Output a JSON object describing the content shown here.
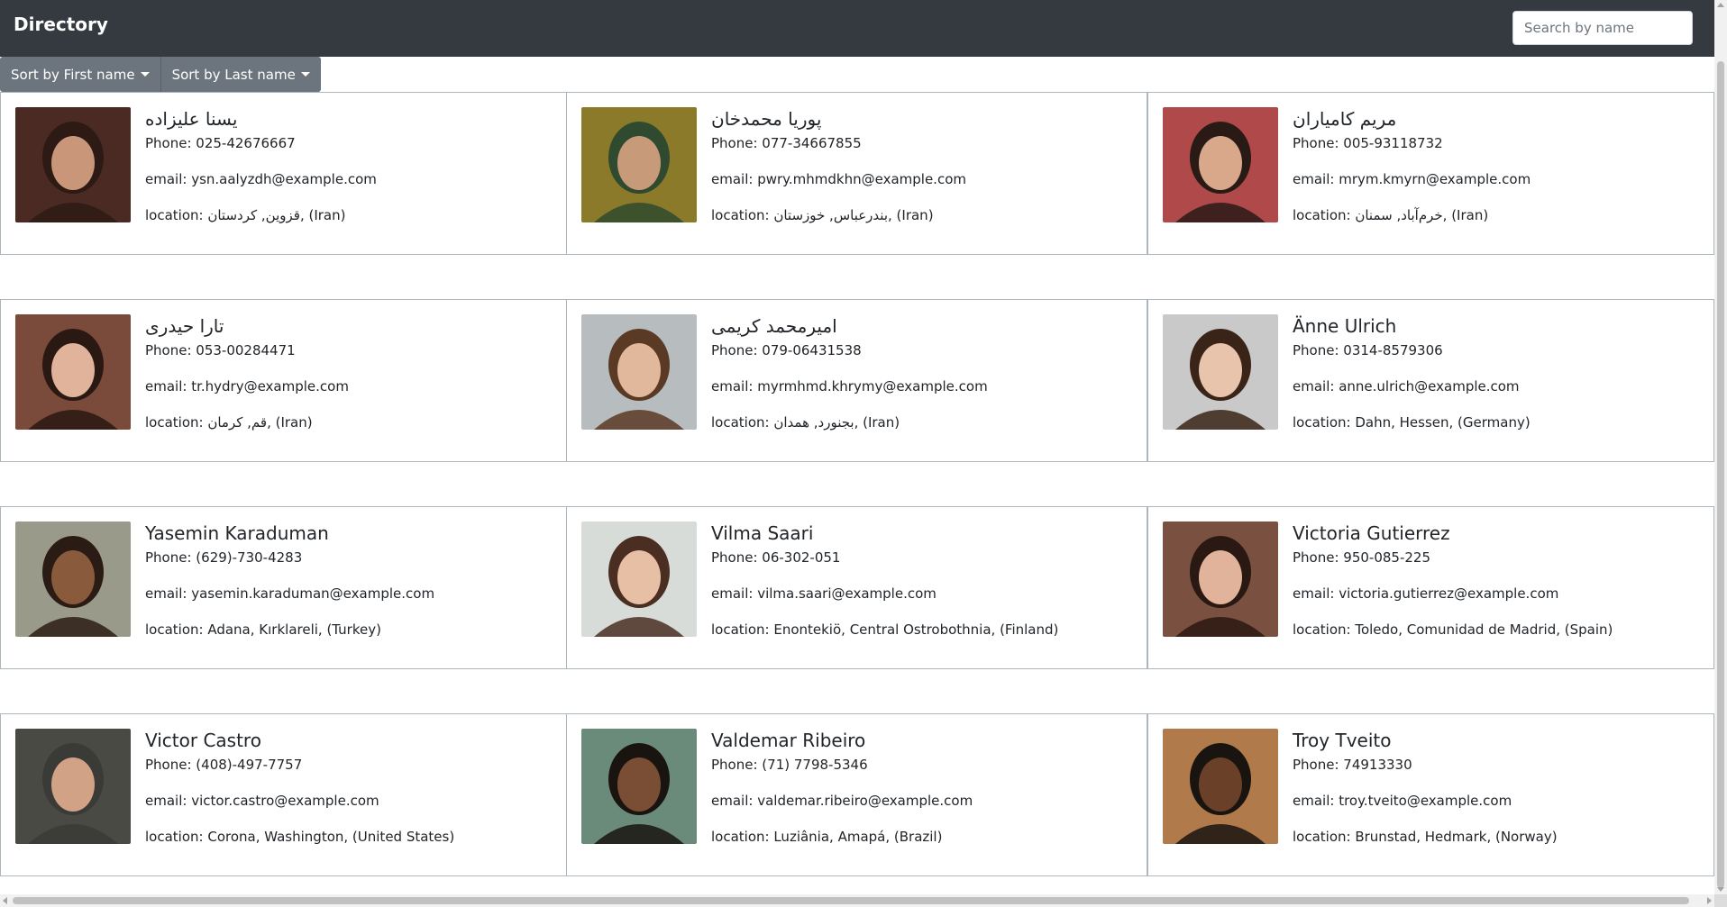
{
  "navbar": {
    "brand": "Directory",
    "search_placeholder": "Search by name",
    "search_value": ""
  },
  "sort": {
    "first_name_label": "Sort by First name",
    "last_name_label": "Sort by Last name"
  },
  "labels": {
    "phone": "Phone: ",
    "email": "email: ",
    "location": "location: "
  },
  "people": [
    {
      "name": "یسنا علیزاده",
      "phone": "025-42676667",
      "email": "ysn.aalyzdh@example.com",
      "location": "قزوین, کردستان, (Iran)",
      "photo_colors": [
        "#4a2a22",
        "#2d1a14",
        "#c9967a"
      ]
    },
    {
      "name": "پوریا محمدخان",
      "phone": "077-34667855",
      "email": "pwry.mhmdkhn@example.com",
      "location": "بندرعباس, خوزستان, (Iran)",
      "photo_colors": [
        "#8a7a2a",
        "#2f4a2e",
        "#c79a7a"
      ]
    },
    {
      "name": "مریم کامیاران",
      "phone": "005-93118732",
      "email": "mrym.kmyrn@example.com",
      "location": "خرم‌آباد, سمنان, (Iran)",
      "photo_colors": [
        "#b04a4a",
        "#2a1a16",
        "#d9a88a"
      ]
    },
    {
      "name": "تارا حیدری",
      "phone": "053-00284471",
      "email": "tr.hydry@example.com",
      "location": "قم, کرمان, (Iran)",
      "photo_colors": [
        "#7a4a3a",
        "#2a1812",
        "#e0b39a"
      ]
    },
    {
      "name": "امیرمحمد کریمی",
      "phone": "079-06431538",
      "email": "myrmhmd.khrymy@example.com",
      "location": "بجنورد, همدان, (Iran)",
      "photo_colors": [
        "#b7bcbf",
        "#5a3a24",
        "#e2b89c"
      ]
    },
    {
      "name": "Änne Ulrich",
      "phone": "0314-8579306",
      "email": "anne.ulrich@example.com",
      "location": "Dahn, Hessen, (Germany)",
      "photo_colors": [
        "#c9c9c9",
        "#3a2418",
        "#e8c4ac"
      ]
    },
    {
      "name": "Yasemin Karaduman",
      "phone": "(629)-730-4283",
      "email": "yasemin.karaduman@example.com",
      "location": "Adana, Kırklareli, (Turkey)",
      "photo_colors": [
        "#9a9a8a",
        "#2a1c14",
        "#8a5a3c"
      ]
    },
    {
      "name": "Vilma Saari",
      "phone": "06-302-051",
      "email": "vilma.saari@example.com",
      "location": "Enontekiö, Central Ostrobothnia, (Finland)",
      "photo_colors": [
        "#d8dcd8",
        "#4a2e22",
        "#e6bfa4"
      ]
    },
    {
      "name": "Victoria Gutierrez",
      "phone": "950-085-225",
      "email": "victoria.gutierrez@example.com",
      "location": "Toledo, Comunidad de Madrid, (Spain)",
      "photo_colors": [
        "#7a5040",
        "#2a1812",
        "#e0b39a"
      ]
    },
    {
      "name": "Victor Castro",
      "phone": "(408)-497-7757",
      "email": "victor.castro@example.com",
      "location": "Corona, Washington, (United States)",
      "photo_colors": [
        "#4a4a44",
        "#3a3a36",
        "#d2a286"
      ]
    },
    {
      "name": "Valdemar Ribeiro",
      "phone": "(71) 7798-5346",
      "email": "valdemar.ribeiro@example.com",
      "location": "Luziânia, Amapá, (Brazil)",
      "photo_colors": [
        "#6a8a7a",
        "#1a1410",
        "#7a4e34"
      ]
    },
    {
      "name": "Troy Tveito",
      "phone": "74913330",
      "email": "troy.tveito@example.com",
      "location": "Brunstad, Hedmark, (Norway)",
      "photo_colors": [
        "#b07a4a",
        "#1a1410",
        "#6a4028"
      ]
    }
  ]
}
